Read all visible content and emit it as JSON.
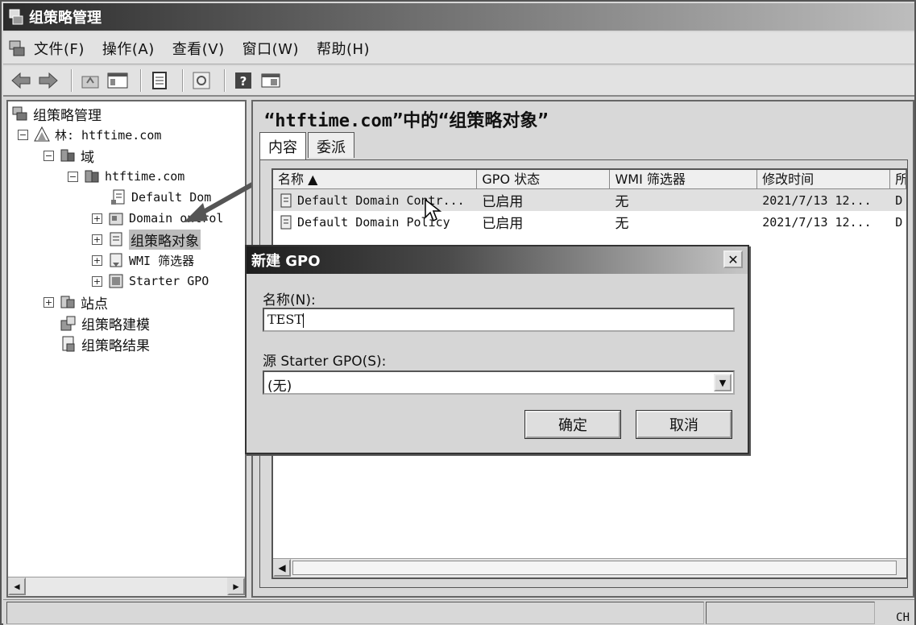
{
  "window": {
    "title": "组策略管理"
  },
  "menu": {
    "items": [
      "文件(F)",
      "操作(A)",
      "查看(V)",
      "窗口(W)",
      "帮助(H)"
    ]
  },
  "toolbar": {
    "buttons": [
      "back-arrow-icon",
      "forward-arrow-icon",
      "up-folder-icon",
      "show-hide-tree-icon",
      "properties-icon",
      "refresh-icon",
      "help-icon",
      "console-icon"
    ]
  },
  "tree": {
    "root": "组策略管理",
    "forest": "林: htftime.com",
    "domains": "域",
    "domain": "htftime.com",
    "default_domain": "Default Dom",
    "domain_controllers": "Domain ontrol",
    "gpo": "组策略对象",
    "wmi": "WMI 筛选器",
    "starter": "Starter GPO",
    "sites": "站点",
    "modeling": "组策略建模",
    "results": "组策略结果"
  },
  "main": {
    "title": "“htftime.com”中的“组策略对象”",
    "tabs": [
      "内容",
      "委派"
    ],
    "columns": [
      "名称 ▲",
      "GPO 状态",
      "WMI 筛选器",
      "修改时间",
      "所"
    ],
    "rows": [
      {
        "name": "Default Domain Contr...",
        "status": "已启用",
        "wmi": "无",
        "modified": "2021/7/13 12...",
        "owner": "D"
      },
      {
        "name": "Default Domain Policy",
        "status": "已启用",
        "wmi": "无",
        "modified": "2021/7/13 12...",
        "owner": "D"
      }
    ]
  },
  "dialog": {
    "title": "新建 GPO",
    "name_label": "名称(N):",
    "name_value": "TEST",
    "source_label": "源 Starter GPO(S):",
    "source_value": "(无)",
    "ok": "确定",
    "cancel": "取消"
  },
  "status": {
    "lang": "CH"
  }
}
